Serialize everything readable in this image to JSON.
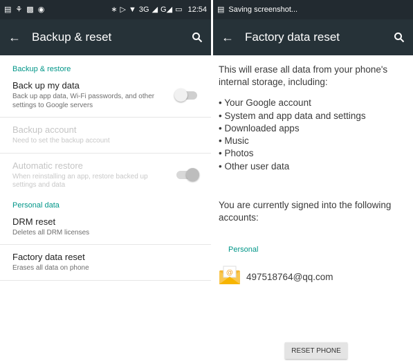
{
  "status_left": {
    "time": "12:54",
    "network": "3G"
  },
  "status_right": {
    "message": "Saving screenshot..."
  },
  "left": {
    "toolbar": {
      "title": "Backup & reset"
    },
    "sections": [
      {
        "header": "Backup & restore"
      },
      {
        "header": "Personal data"
      }
    ],
    "items": [
      {
        "title": "Back up my data",
        "subtitle": "Back up app data, Wi-Fi passwords, and other settings to Google servers",
        "toggle": "off",
        "enabled": true
      },
      {
        "title": "Backup account",
        "subtitle": "Need to set the backup account",
        "enabled": false
      },
      {
        "title": "Automatic restore",
        "subtitle": "When reinstalling an app, restore backed up settings and data",
        "toggle": "on",
        "enabled": false
      },
      {
        "title": "DRM reset",
        "subtitle": "Deletes all DRM licenses",
        "enabled": true
      },
      {
        "title": "Factory data reset",
        "subtitle": "Erases all data on phone",
        "enabled": true
      }
    ]
  },
  "right": {
    "toolbar": {
      "title": "Factory data reset"
    },
    "intro": "This will erase all data from your phone's internal storage, including:",
    "list": [
      "Your Google account",
      "System and app data and settings",
      "Downloaded apps",
      "Music",
      "Photos",
      "Other user data"
    ],
    "signed_in": "You are currently signed into the following accounts:",
    "account_group": "Personal",
    "account_email": "497518764@qq.com",
    "reset_button": "RESET PHONE"
  },
  "colors": {
    "toolbar": "#263238",
    "statusbar": "#222a30",
    "accent": "#009688"
  },
  "icons": [
    "back-arrow-icon",
    "search-icon",
    "email-account-icon"
  ]
}
